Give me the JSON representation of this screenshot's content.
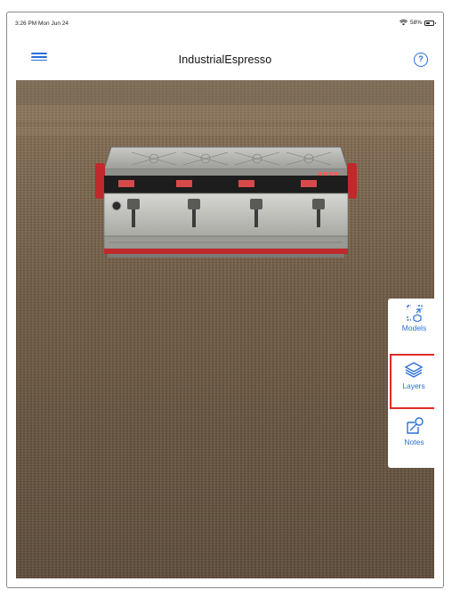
{
  "status_bar": {
    "time_date": "3:26 PM  Mon Jun 24",
    "battery_text": "58%",
    "battery_level": 0.58
  },
  "nav": {
    "title": "IndustrialEspresso",
    "menu_icon": "hamburger-icon",
    "help_icon": "help-icon",
    "help_glyph": "?"
  },
  "toolbar": {
    "items": [
      {
        "label": "Models",
        "icon": "models-icon",
        "selected": false
      },
      {
        "label": "Layers",
        "icon": "layers-icon",
        "selected": true
      },
      {
        "label": "Notes",
        "icon": "notes-icon",
        "selected": false
      }
    ]
  },
  "colors": {
    "accent": "#2a6fd6",
    "highlight": "#e02a2a",
    "machine_accent": "#c0282b"
  }
}
